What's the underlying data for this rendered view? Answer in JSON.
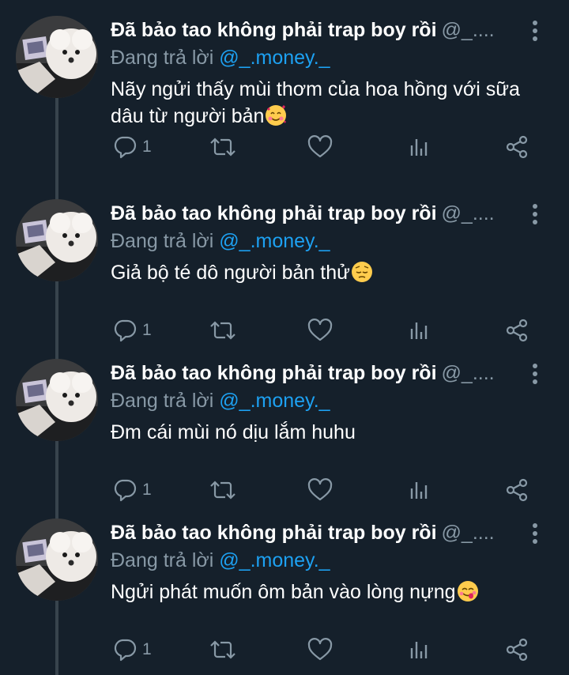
{
  "colors": {
    "background": "#15202b",
    "secondary_text": "#8899a6",
    "link": "#1da1f2",
    "thread_line": "#38444d"
  },
  "tweets": [
    {
      "display_name": "Đã bảo tao không phải trap boy rồi",
      "handle": "@_....",
      "replying_label": "Đang trả lời",
      "replying_to": "@_.money._",
      "text": "Nãy ngửi thấy mùi thơm của hoa hồng với sữa dâu từ người bản",
      "emoji": "smiling-face-with-hearts",
      "reply_count": "1"
    },
    {
      "display_name": "Đã bảo tao không phải trap boy rồi",
      "handle": "@_....",
      "replying_label": "Đang trả lời",
      "replying_to": "@_.money._",
      "text": "Giả bộ té dô người bản thử",
      "emoji": "pensive-face",
      "reply_count": "1"
    },
    {
      "display_name": "Đã bảo tao không phải trap boy rồi",
      "handle": "@_....",
      "replying_label": "Đang trả lời",
      "replying_to": "@_.money._",
      "text": "Đm cái mùi nó dịu lắm huhu",
      "emoji": "",
      "reply_count": "1"
    },
    {
      "display_name": "Đã bảo tao không phải trap boy rồi",
      "handle": "@_....",
      "replying_label": "Đang trả lời",
      "replying_to": "@_.money._",
      "text": "Ngửi phát muốn ôm bản vào lòng nựng",
      "emoji": "face-savoring-food",
      "reply_count": "1"
    }
  ],
  "icons": [
    "reply-icon",
    "retweet-icon",
    "like-icon",
    "analytics-icon",
    "share-icon",
    "more-icon"
  ]
}
